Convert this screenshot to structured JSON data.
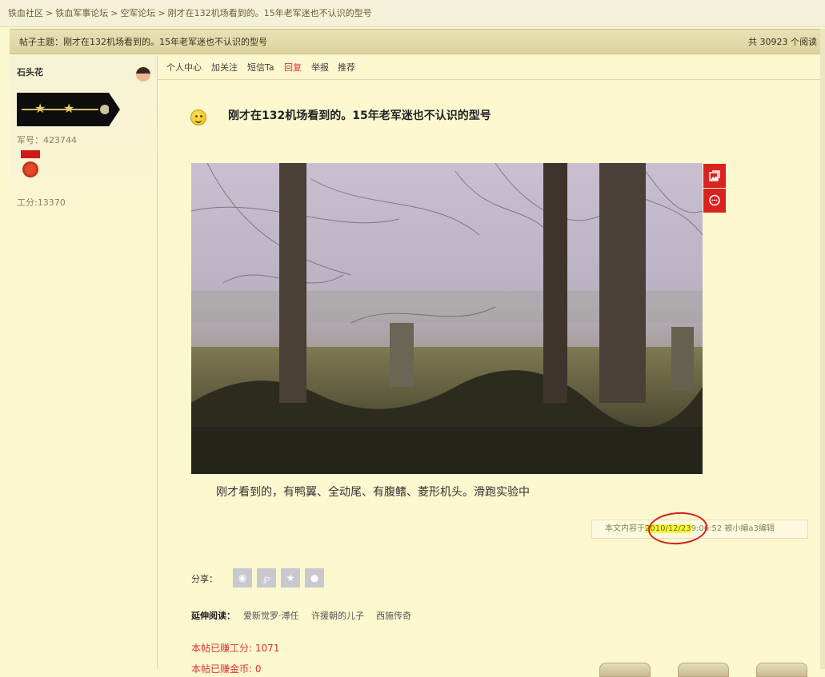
{
  "breadcrumb": {
    "items": [
      "铁血社区",
      "铁血军事论坛",
      "空军论坛",
      "刚才在132机场看到的。15年老军迷也不认识的型号"
    ],
    "separator": ">"
  },
  "topic_bar": {
    "label": "帖子主题：刚才在132机场看到的。15年老军迷也不认识的型号",
    "count": "共 30923 个阅读"
  },
  "author": {
    "name": "石头花",
    "military_id": "军号：423744",
    "gongfen": "工分:13370"
  },
  "actions": [
    "个人中心",
    "加关注",
    "短信Ta",
    "回复",
    "举报",
    "推荐"
  ],
  "post": {
    "title": "刚才在132机场看到的。15年老军迷也不认识的型号",
    "body": "刚才看到的，有鸭翼、全动尾、有腹鳍、菱形机头。滑跑实验中",
    "edit_prefix": "本文内容于",
    "edit_date": "2010/12/23",
    "edit_suffix": "9:06:52 被小编a3编辑"
  },
  "share": {
    "label": "分享：",
    "icons": [
      "weibo-icon",
      "tencent-weibo-icon",
      "qzone-star-icon",
      "wechat-icon"
    ]
  },
  "extended_reading": {
    "label": "延伸阅读：",
    "links": [
      "爱新觉罗·溥任",
      "许援朝的儿子",
      "西施传奇"
    ]
  },
  "earned": {
    "gongfen": "本帖已赚工分: 1071",
    "coins": "本帖已赚金币: 0"
  },
  "colors": {
    "page_bg": "#fbf7cf",
    "accent_red": "#d8231f",
    "highlight": "#f6f53a"
  }
}
